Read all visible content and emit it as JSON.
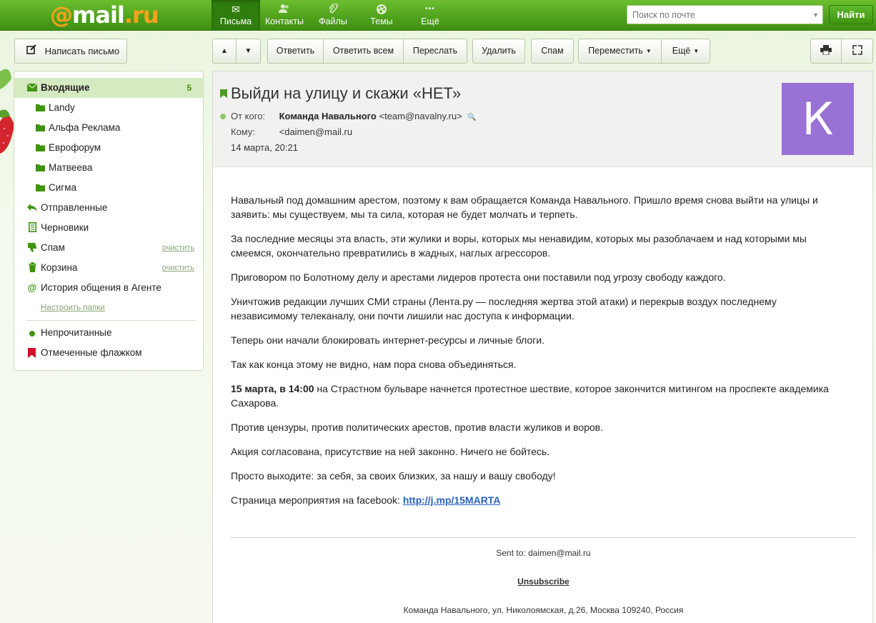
{
  "brand": {
    "at": "@",
    "name": "mail",
    "tld": ".ru"
  },
  "nav": [
    {
      "label": "Письма",
      "icon": "envelope-icon",
      "glyph": "✉",
      "active": true
    },
    {
      "label": "Контакты",
      "icon": "contacts-icon",
      "glyph": "👥",
      "active": false
    },
    {
      "label": "Файлы",
      "icon": "paperclip-icon",
      "glyph": "📎",
      "active": false
    },
    {
      "label": "Темы",
      "icon": "palette-icon",
      "glyph": "🎨",
      "active": false
    },
    {
      "label": "Ещё",
      "icon": "more-icon",
      "glyph": "•••",
      "active": false
    }
  ],
  "search": {
    "placeholder": "Поиск по почте",
    "button": "Найти"
  },
  "compose": {
    "label": "Написать письмо"
  },
  "folders": {
    "inbox": {
      "label": "Входящие",
      "count": "5"
    },
    "subfolders": [
      "Landy",
      "Альфа Реклама",
      "Еврофорум",
      "Матвеева",
      "Сигма"
    ],
    "sent": "Отправленные",
    "drafts": "Черновики",
    "spam": "Спам",
    "trash": "Корзина",
    "clean": "очистить",
    "agent": "История общения в Агенте",
    "settings": "Настроить папки",
    "unread": "Непрочитанные",
    "flagged": "Отмеченные флажком"
  },
  "toolbar": {
    "up": "▲",
    "down": "▼",
    "reply": "Ответить",
    "reply_all": "Ответить всем",
    "forward": "Переслать",
    "delete": "Удалить",
    "spam": "Спам",
    "move": "Переместить",
    "more": "Ещё"
  },
  "message": {
    "subject": "Выйди на улицу и скажи «НЕТ»",
    "from_label": "От кого:",
    "from_name": "Команда Навального",
    "from_email": "<team@navalny.ru>",
    "to_label": "Кому:",
    "to_email": "<daimen@mail.ru",
    "date": "14 марта, 20:21",
    "avatar_letter": "К",
    "avatar_color": "#9a71d4",
    "paragraphs": [
      "Навальный под домашним арестом, поэтому к вам обращается Команда Навального. Пришло время снова выйти на улицы и заявить: мы существуем, мы та сила, которая не будет молчать и терпеть.",
      "За последние месяцы эта власть, эти жулики и воры, которых мы ненавидим, которых мы разоблачаем и над которыми мы смеемся, окончательно превратились в жадных, наглых агрессоров.",
      "Приговором по Болотному делу и арестами лидеров протеста они поставили под угрозу свободу каждого.",
      "Уничтожив редакции лучших СМИ страны (Лента.ру — последняя жертва этой атаки) и перекрыв воздух последнему независимому телеканалу, они почти лишили нас доступа к информации.",
      "Теперь они начали блокировать интернет-ресурсы и личные блоги.",
      "Так как конца этому не видно, нам пора снова объединяться."
    ],
    "event_bold": "15 марта, в 14:00",
    "event_rest": " на Страстном бульваре начнется протестное шествие, которое закончится митингом на проспекте академика Сахарова.",
    "paragraphs2": [
      "Против цензуры, против политических арестов, против власти жуликов и воров.",
      "Акция согласована, присутствие на ней законно. Ничего не бойтесь.",
      "Просто выходите: за себя, за своих близких, за нашу и вашу свободу!"
    ],
    "fb_label": "Страница мероприятия на facebook: ",
    "fb_link": "http://j.mp/15MARTA",
    "sent_to": "Sent to: daimen@mail.ru",
    "unsubscribe": "Unsubscribe",
    "address": "Команда Навального, ул. Николоямская, д.26, Москва 109240, Россия"
  }
}
